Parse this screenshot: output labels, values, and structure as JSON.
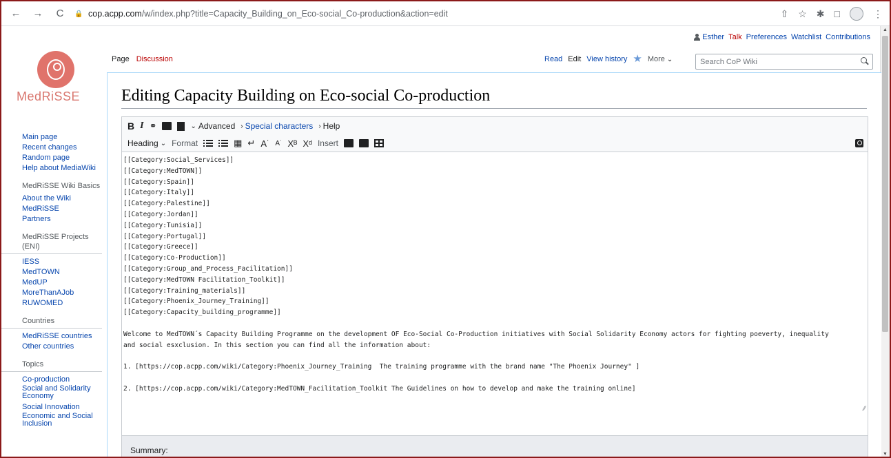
{
  "browser": {
    "back": "←",
    "forward": "→",
    "reload": "C",
    "url_host": "cop.acpp.com",
    "url_rest": "/w/index.php?title=Capacity_Building_on_Eco-social_Co-production&action=edit",
    "icons": [
      "share-icon",
      "bookmark-star-icon",
      "extensions-icon",
      "sidebar-icon",
      "profile-icon",
      "menu-icon"
    ]
  },
  "personal_tools": {
    "user": "Esther",
    "talk": "Talk",
    "preferences": "Preferences",
    "watchlist": "Watchlist",
    "contributions": "Contributions"
  },
  "logo": {
    "text": "MedRiSSE",
    "color": "#d9776f"
  },
  "sidebar": {
    "nav": [
      "Main page",
      "Recent changes",
      "Random page",
      "Help about MediaWiki"
    ],
    "basics": {
      "heading": "MedRiSSE Wiki Basics",
      "items": [
        "About the Wiki",
        "MedRiSSE",
        "Partners"
      ]
    },
    "projects": {
      "heading": "MedRiSSE Projects (ENI)",
      "items": [
        "IESS",
        "MedTOWN",
        "MedUP",
        "MoreThanAJob",
        "RUWOMED"
      ]
    },
    "countries": {
      "heading": "Countries",
      "items": [
        "MedRiSSE countries",
        "Other countries"
      ]
    },
    "topics": {
      "heading": "Topics",
      "items": [
        "Co-production",
        "Social and Solidarity Economy",
        "Social Innovation",
        "Economic and Social Inclusion"
      ]
    }
  },
  "tabs": {
    "page": "Page",
    "discussion": "Discussion",
    "read": "Read",
    "edit": "Edit",
    "history": "View history",
    "more": "More"
  },
  "search": {
    "placeholder": "Search CoP Wiki"
  },
  "page_title": "Editing Capacity Building on Eco-social Co-production",
  "toolbar": {
    "bold": "B",
    "italic": "I",
    "advanced": "Advanced",
    "special_characters": "Special characters",
    "help": "Help",
    "heading": "Heading",
    "format": "Format",
    "insert": "Insert"
  },
  "editor_text": "[[Category:Social_Services]]\n[[Category:MedTOWN]]\n[[Category:Spain]]\n[[Category:Italy]]\n[[Category:Palestine]]\n[[Category:Jordan]]\n[[Category:Tunisia]]\n[[Category:Portugal]]\n[[Category:Greece]]\n[[Category:Co-Production]]\n[[Category:Group_and_Process_Facilitation]]\n[[Category:MedTOWN Facilitation_Toolkit]]\n[[Category:Training_materials]]\n[[Category:Phoenix_Journey_Training]]\n[[Category:Capacity_building_programme]]\n\nWelcome to MedTOWN´s Capacity Building Programme on the development OF Eco-Social Co-Production initiatives with Social Solidarity Economy actors for fighting poeverty, inequality\nand social esxclusion. In this section you can find all the information about:\n\n1. [https://cop.acpp.com/wiki/Category:Phoenix_Journey_Training  The training programme with the brand name \"The Phoenix Journey\" ]\n\n2. [https://cop.acpp.com/wiki/Category:MedTOWN_Facilitation_Toolkit The Guidelines on how to develop and make the training online]",
  "summary_label": "Summary:"
}
